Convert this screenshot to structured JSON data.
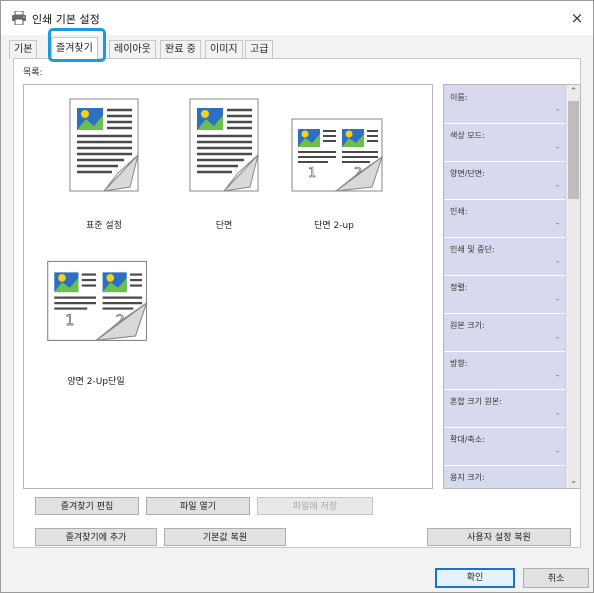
{
  "window": {
    "title": "인쇄 기본 설정",
    "close_glyph": "×"
  },
  "tabs": [
    {
      "label": "기본",
      "active": false
    },
    {
      "label": "즐겨찾기",
      "active": true
    },
    {
      "label": "레이아웃",
      "active": false
    },
    {
      "label": "완료 중",
      "active": false
    },
    {
      "label": "이미지",
      "active": false
    },
    {
      "label": "고급",
      "active": false
    }
  ],
  "list": {
    "label": "목록:",
    "items": [
      {
        "label": "표준 설정",
        "icon": "single-page-icon"
      },
      {
        "label": "단면",
        "icon": "single-page-icon"
      },
      {
        "label": "단면 2-up",
        "icon": "two-up-page-icon",
        "numbers": [
          "1",
          "2"
        ]
      },
      {
        "label": "양면 2-Up단일",
        "icon": "two-up-page-icon",
        "numbers": [
          "1",
          "2"
        ]
      }
    ]
  },
  "properties": [
    {
      "name": "이름:",
      "value": "-"
    },
    {
      "name": "색상 모드:",
      "value": "-"
    },
    {
      "name": "양면/단면:",
      "value": "-"
    },
    {
      "name": "인쇄:",
      "value": "-"
    },
    {
      "name": "인쇄 및 중단:",
      "value": "-"
    },
    {
      "name": "정렬:",
      "value": "-"
    },
    {
      "name": "원본 크기:",
      "value": "-"
    },
    {
      "name": "방향:",
      "value": "-"
    },
    {
      "name": "혼합 크기 원본:",
      "value": "-"
    },
    {
      "name": "확대/축소:",
      "value": "-"
    },
    {
      "name": "용지 크기:",
      "value": ""
    }
  ],
  "scrollbar": {
    "up_glyph": "⌃",
    "down_glyph": "⌄"
  },
  "buttons": {
    "edit": "즐겨찾기 편집",
    "open_file": "파일 열기",
    "save_file": "파일에 저장",
    "add_favorite": "즐겨찾기에 추가",
    "restore_default": "기본값 복원",
    "restore_user": "사용자 설정 복원",
    "ok": "확인",
    "cancel": "취소"
  },
  "colors": {
    "accent": "#1a9be0",
    "props_bg": "#d8d8ee",
    "doc_blue": "#2d6fc4",
    "doc_green": "#6cc04a",
    "doc_yellow": "#f2d21b"
  }
}
